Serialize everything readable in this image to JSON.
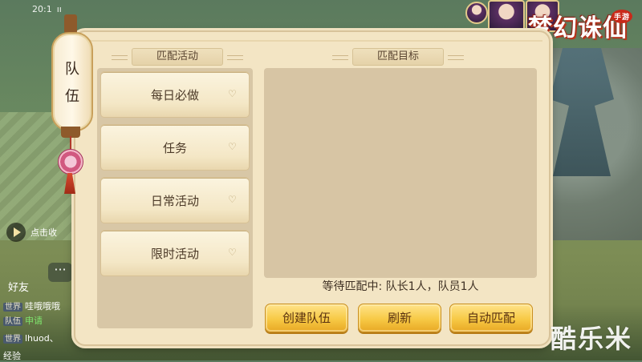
{
  "logo": {
    "text": "梦幻诛仙",
    "seal": "手游"
  },
  "watermark": "酷乐米",
  "topbar": {
    "time": "20:1",
    "signal": "ıı"
  },
  "lantern_tab": {
    "chars": [
      "队",
      "伍"
    ]
  },
  "panel": {
    "left_title": "匹配活动",
    "right_title": "匹配目标",
    "activities": [
      {
        "label": "每日必做"
      },
      {
        "label": "任务"
      },
      {
        "label": "日常活动"
      },
      {
        "label": "限时活动"
      }
    ],
    "status": "等待匹配中: 队长1人，队员1人",
    "buttons": {
      "create": "创建队伍",
      "refresh": "刷新",
      "auto_match": "自动匹配"
    }
  },
  "chat": {
    "play_label": "点击收",
    "friends_label": "好友",
    "bubble": "···",
    "lines": [
      {
        "tag": "世界",
        "text": "哇哦哦哦"
      },
      {
        "tag": "队伍",
        "text": "申请"
      },
      {
        "tag": "世界",
        "text": "lhuod、"
      },
      {
        "tag": "",
        "text": "经验"
      }
    ]
  },
  "colors": {
    "panel_bg": "#f3e5c4",
    "button_gold": "#f7c945",
    "text_dark": "#4c3a28"
  }
}
